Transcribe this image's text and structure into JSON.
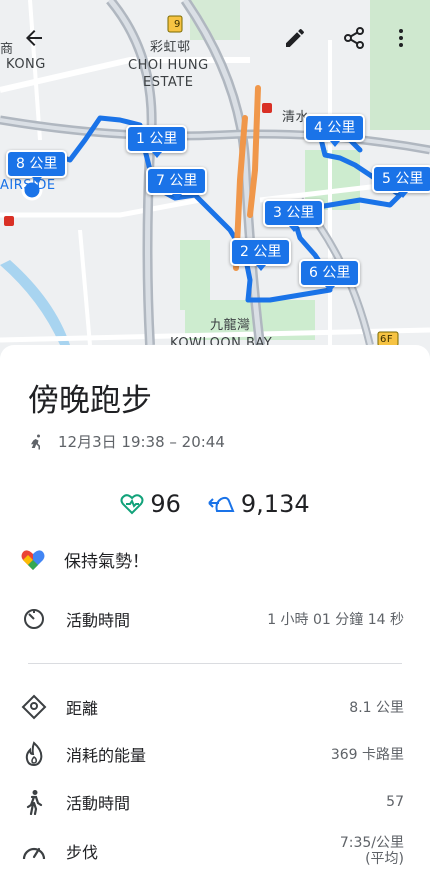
{
  "map": {
    "labels": {
      "choi_hung_cn": "彩虹邨",
      "choi_hung_en1": "CHOI HUNG",
      "choi_hung_en2": "ESTATE",
      "kowloon_bay_cn": "九龍灣",
      "kowloon_bay_en": "KOWLOON BAY",
      "kong": "KONG",
      "airside": "AIRSIDE",
      "partial_cn": "商",
      "qingshui_partial": "清水",
      "route_9": "9",
      "route_6f": "6F"
    },
    "km_markers": [
      "1 公里",
      "2 公里",
      "3 公里",
      "4 公里",
      "5 公里",
      "6 公里",
      "7 公里",
      "8 公里"
    ],
    "route_color": "#1a73e8",
    "annotation_color": "#f0974a"
  },
  "toolbar": {
    "back_icon": "arrow-back-icon",
    "edit_icon": "pencil-icon",
    "share_icon": "share-icon",
    "more_icon": "more-vert-icon"
  },
  "activity": {
    "title": "傍晚跑步",
    "time_range": "12月3日 19:38 – 20:44",
    "heart_points": "96",
    "steps": "9,134",
    "motivation": "保持氣勢！"
  },
  "details": [
    {
      "label": "活動時間",
      "value": "1 小時 01 分鐘 14 秒",
      "icon": "timer-icon"
    },
    {
      "label": "距離",
      "value": "8.1 公里",
      "icon": "location-diamond-icon"
    },
    {
      "label": "消耗的能量",
      "value": "369 卡路里",
      "icon": "flame-icon"
    },
    {
      "label": "活動時間",
      "value": "57",
      "icon": "walking-icon"
    },
    {
      "label": "步伐",
      "value": "7:35/公里",
      "value2": "(平均)",
      "icon": "speedometer-icon"
    }
  ],
  "colors": {
    "heart_green": "#12a27a",
    "steps_blue": "#1a73e8",
    "text_dark": "#202124",
    "text_gray": "#5f6368"
  }
}
